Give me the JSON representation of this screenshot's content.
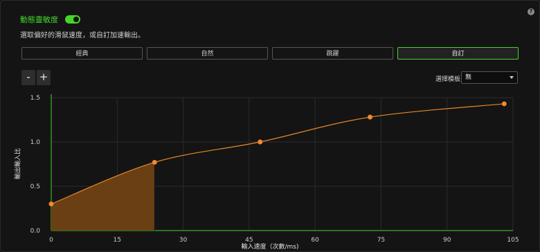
{
  "header": {
    "title": "動態靈敏度",
    "toggle_on": true,
    "help_icon": "question-icon"
  },
  "description": "選取偏好的滑鼠速度，或自訂加速輸出。",
  "presets": [
    {
      "label": "經典",
      "active": false
    },
    {
      "label": "自然",
      "active": false
    },
    {
      "label": "跳躍",
      "active": false
    },
    {
      "label": "自訂",
      "active": true
    }
  ],
  "zoom": {
    "minus_label": "-",
    "plus_label": "+"
  },
  "template": {
    "label": "選擇模板",
    "selected": "無"
  },
  "colors": {
    "accent": "#44d62c",
    "curve": "#e8872a",
    "fill": "#6a3f14",
    "point": "#f08a2c"
  },
  "chart_data": {
    "type": "line",
    "xlabel": "輸入速度（次數/ms)",
    "ylabel": "輸出輸入比",
    "xlim": [
      0,
      105
    ],
    "ylim": [
      0,
      1.5
    ],
    "x_ticks": [
      "0",
      "15",
      "30",
      "45",
      "60",
      "75",
      "90",
      "105"
    ],
    "y_ticks": [
      "0.0",
      "0.5",
      "1.0",
      "1.5"
    ],
    "grid": true,
    "points": [
      {
        "x": 0,
        "y": 0.3
      },
      {
        "x": 23.5,
        "y": 0.77
      },
      {
        "x": 47.5,
        "y": 1.0
      },
      {
        "x": 72.5,
        "y": 1.28
      },
      {
        "x": 103,
        "y": 1.43
      }
    ],
    "shaded_range": [
      0,
      23.5
    ]
  }
}
